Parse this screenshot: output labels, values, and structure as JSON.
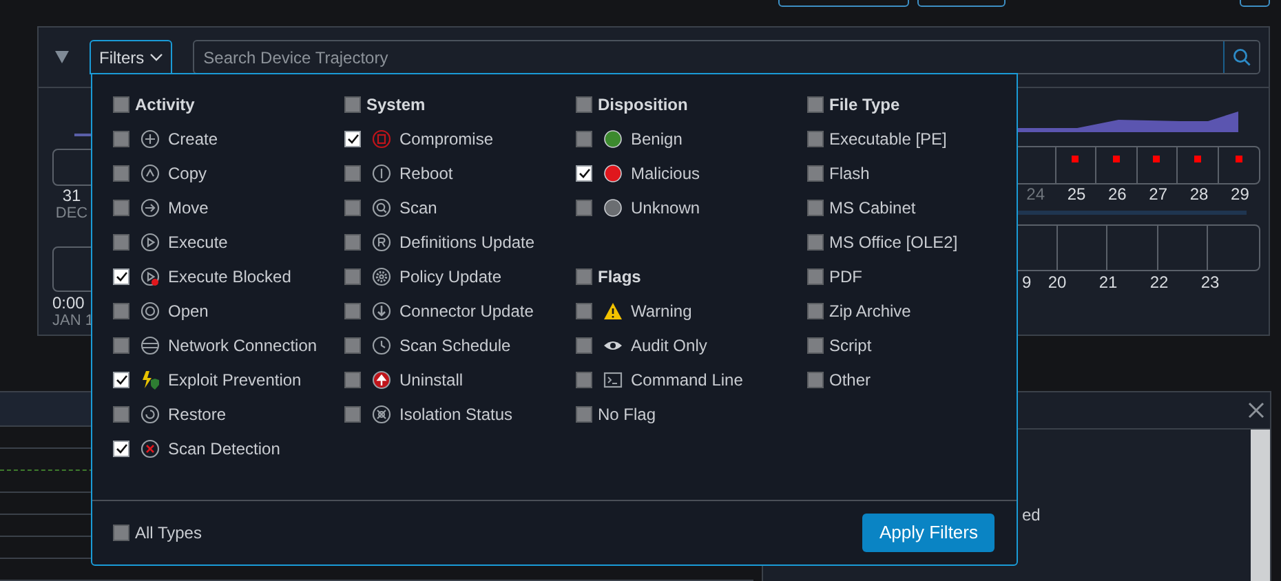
{
  "toolbar": {
    "filters_button": "Filters",
    "search": {
      "placeholder": "Search Device Trajectory"
    }
  },
  "timeline": {
    "left_dates": [
      {
        "day": "31",
        "month": "DEC"
      }
    ],
    "left_times": [
      {
        "time": "0:00",
        "date": "JAN 1"
      }
    ],
    "day_cells": [
      {
        "label": "24",
        "dimmed": true,
        "alert": false
      },
      {
        "label": "25",
        "dimmed": false,
        "alert": true
      },
      {
        "label": "26",
        "dimmed": false,
        "alert": true
      },
      {
        "label": "27",
        "dimmed": false,
        "alert": true
      },
      {
        "label": "28",
        "dimmed": false,
        "alert": true
      },
      {
        "label": "29",
        "dimmed": false,
        "alert": true
      }
    ],
    "hour_cells": [
      "9",
      "20",
      "21",
      "22",
      "23"
    ]
  },
  "filter_menu": {
    "columns": [
      {
        "groups": [
          {
            "title": "Activity",
            "checked": false,
            "items": [
              {
                "label": "Create",
                "checked": false
              },
              {
                "label": "Copy",
                "checked": false
              },
              {
                "label": "Move",
                "checked": false
              },
              {
                "label": "Execute",
                "checked": false
              },
              {
                "label": "Execute Blocked",
                "checked": true
              },
              {
                "label": "Open",
                "checked": false
              },
              {
                "label": "Network Connection",
                "checked": false
              },
              {
                "label": "Exploit Prevention",
                "checked": true
              },
              {
                "label": "Restore",
                "checked": false
              },
              {
                "label": "Scan Detection",
                "checked": true
              }
            ]
          }
        ]
      },
      {
        "groups": [
          {
            "title": "System",
            "checked": false,
            "items": [
              {
                "label": "Compromise",
                "checked": true
              },
              {
                "label": "Reboot",
                "checked": false
              },
              {
                "label": "Scan",
                "checked": false
              },
              {
                "label": "Definitions Update",
                "checked": false
              },
              {
                "label": "Policy Update",
                "checked": false
              },
              {
                "label": "Connector Update",
                "checked": false
              },
              {
                "label": "Scan Schedule",
                "checked": false
              },
              {
                "label": "Uninstall",
                "checked": false
              },
              {
                "label": "Isolation Status",
                "checked": false
              }
            ]
          }
        ]
      },
      {
        "groups": [
          {
            "title": "Disposition",
            "checked": false,
            "items": [
              {
                "label": "Benign",
                "checked": false,
                "color": "#3c8a2e"
              },
              {
                "label": "Malicious",
                "checked": true,
                "color": "#e0171d"
              },
              {
                "label": "Unknown",
                "checked": false,
                "color": "#6b6e72"
              }
            ]
          },
          {
            "title": "Flags",
            "checked": false,
            "items": [
              {
                "label": "Warning",
                "checked": false
              },
              {
                "label": "Audit Only",
                "checked": false
              },
              {
                "label": "Command Line",
                "checked": false
              },
              {
                "label": "No Flag",
                "checked": false
              }
            ]
          }
        ]
      },
      {
        "groups": [
          {
            "title": "File Type",
            "checked": false,
            "items": [
              {
                "label": "Executable [PE]",
                "checked": false
              },
              {
                "label": "Flash",
                "checked": false
              },
              {
                "label": "MS Cabinet",
                "checked": false
              },
              {
                "label": "MS Office [OLE2]",
                "checked": false
              },
              {
                "label": "PDF",
                "checked": false
              },
              {
                "label": "Zip Archive",
                "checked": false
              },
              {
                "label": "Script",
                "checked": false
              },
              {
                "label": "Other",
                "checked": false
              }
            ]
          }
        ]
      }
    ],
    "all_types": {
      "label": "All Types",
      "checked": false
    },
    "apply_button": "Apply Filters"
  },
  "detail_panel": {
    "text": "ed"
  }
}
